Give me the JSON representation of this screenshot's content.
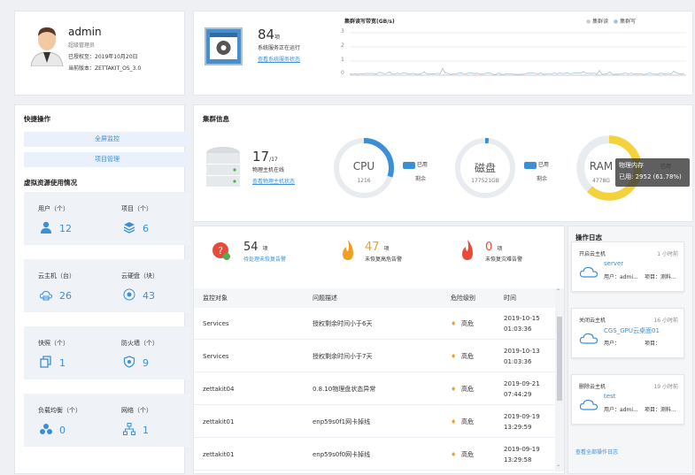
{
  "user": {
    "name": "admin",
    "role": "超级管理员",
    "auth": "已授权至：2019年10月20日",
    "version": "当前版本：ZETTAKIT_OS_3.0"
  },
  "service": {
    "count": "84",
    "unit": "项",
    "status": "系统服务正在运行",
    "link": "查看系统服务状态"
  },
  "io_chart": {
    "title": "集群读写带宽(GB/s)",
    "legend": [
      "集群读",
      "集群写"
    ],
    "yticks": [
      "3",
      "2",
      "1",
      "0"
    ],
    "chart_data": {
      "type": "line",
      "title": "集群读写带宽(GB/s)",
      "ylim": [
        0,
        3
      ],
      "series": [
        {
          "name": "集群读"
        },
        {
          "name": "集群写"
        }
      ]
    }
  },
  "quick": {
    "title": "快捷操作",
    "items": [
      "全屏监控",
      "项目管理"
    ]
  },
  "resources": {
    "title": "虚拟资源使用情况",
    "items": [
      {
        "label": "用户（个）",
        "value": "12",
        "icon": "user-icon"
      },
      {
        "label": "项目（个）",
        "value": "6",
        "icon": "layers-icon"
      },
      {
        "label": "云主机（台）",
        "value": "26",
        "icon": "cloud-icon"
      },
      {
        "label": "云硬盘（块）",
        "value": "43",
        "icon": "disk-icon"
      },
      {
        "label": "快照（个）",
        "value": "1",
        "icon": "snapshot-icon"
      },
      {
        "label": "防火墙（个）",
        "value": "9",
        "icon": "shield-icon"
      },
      {
        "label": "负载均衡（个）",
        "value": "0",
        "icon": "balancer-icon"
      },
      {
        "label": "网络（个）",
        "value": "1",
        "icon": "network-icon"
      }
    ]
  },
  "cluster": {
    "title": "集群信息",
    "hosts": "17",
    "hosts_total": "/17",
    "hosts_label": "物理主机在线",
    "hosts_link": "查看物理主机状态",
    "cpu": {
      "name": "CPU",
      "sub": "1216",
      "used": 0.3,
      "legend": [
        "已用",
        "剩余"
      ]
    },
    "disk": {
      "name": "磁盘",
      "sub": "177521GB",
      "used": 0.02,
      "legend": [
        "已用",
        "剩余"
      ]
    },
    "ram": {
      "name": "RAM",
      "sub": "4778G",
      "used": 0.6178,
      "legend": [
        "已用"
      ],
      "tooltip_title": "物理内存",
      "tooltip_value": "已用: 2952 (61.78%)"
    }
  },
  "alerts_summary": [
    {
      "count": "54",
      "unit": "项",
      "label": "待处理未恢复告警",
      "color": "#333"
    },
    {
      "count": "47",
      "unit": "项",
      "label": "未恢复高危告警",
      "color": "#f0a020"
    },
    {
      "count": "0",
      "unit": "项",
      "label": "未恢复灾难告警",
      "color": "#e84a3a"
    }
  ],
  "alerts_table": {
    "headers": [
      "监控对象",
      "问题描述",
      "危险级别",
      "时间"
    ],
    "rows": [
      [
        "Services",
        "授权剩余时间小于6天",
        "高危",
        "2019-10-15",
        "01:03:36"
      ],
      [
        "Services",
        "授权剩余时间小于7天",
        "高危",
        "2019-10-13",
        "01:03:36"
      ],
      [
        "zettakit04",
        "0.8.10物理盘状态异常",
        "高危",
        "2019-09-21",
        "07:44:29"
      ],
      [
        "zettakit01",
        "enp59s0f1网卡掉线",
        "高危",
        "2019-09-19",
        "13:29:59"
      ],
      [
        "zettakit01",
        "enp59s0f0网卡掉线",
        "高危",
        "2019-09-19",
        "13:29:58"
      ]
    ]
  },
  "oplog": {
    "title": "操作日志",
    "more": "查看全部操作日志",
    "items": [
      {
        "action": "开启云主机",
        "time": "1 小时前",
        "target": "server",
        "user": "用户：admi...",
        "project": "项目：测料..."
      },
      {
        "action": "关闭云主机",
        "time": "16 小时前",
        "target": "CGS_GPU云桌面01",
        "user": "用户：",
        "project": "项目："
      },
      {
        "action": "删除云主机",
        "time": "19 小时前",
        "target": "test",
        "user": "用户：admi...",
        "project": "项目：测料..."
      }
    ]
  },
  "colors": {
    "accent": "#3a8fd6",
    "ram": "#f5d23c",
    "ring_bg": "#e8ecf0"
  }
}
